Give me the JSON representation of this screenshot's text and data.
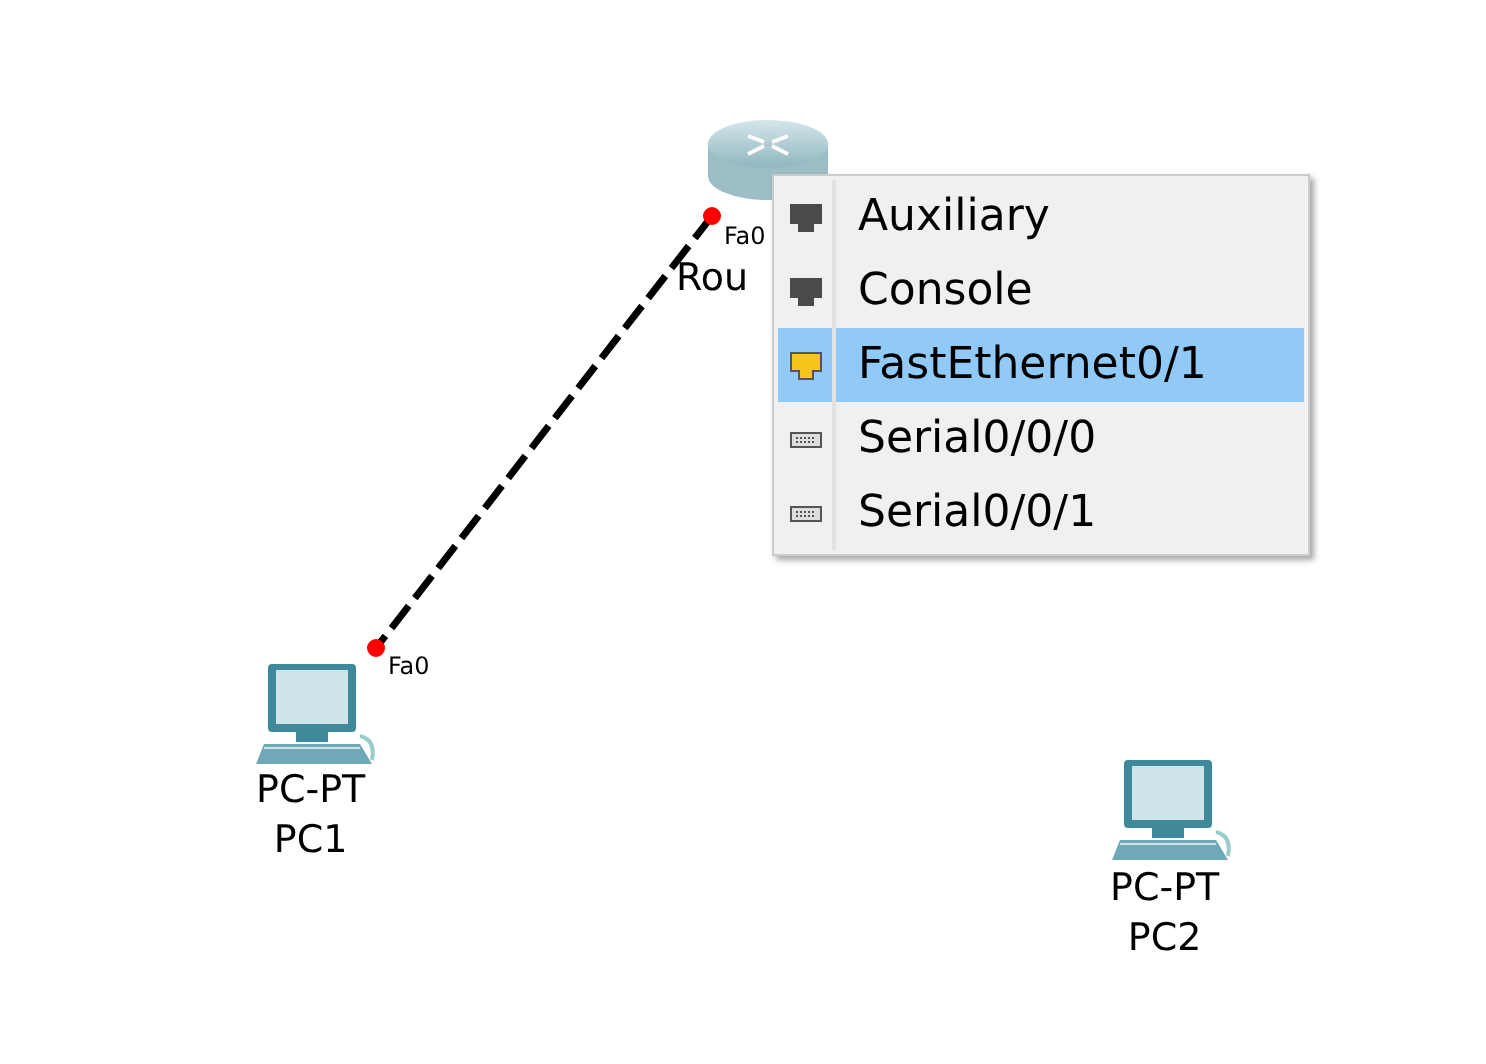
{
  "devices": [
    {
      "kind": "router",
      "labels": [
        "Rou"
      ]
    },
    {
      "kind": "pc",
      "labels": [
        "PC-PT",
        "PC1"
      ]
    },
    {
      "kind": "pc",
      "labels": [
        "PC-PT",
        "PC2"
      ]
    }
  ],
  "links": [
    {
      "from_port": "Fa0",
      "to_port": "Fa0"
    }
  ],
  "port_menu": {
    "items": [
      {
        "label": "Auxiliary",
        "kind": "console",
        "selected": false
      },
      {
        "label": "Console",
        "kind": "console",
        "selected": false
      },
      {
        "label": "FastEthernet0/1",
        "kind": "ethernet",
        "selected": true
      },
      {
        "label": "Serial0/0/0",
        "kind": "serial",
        "selected": false
      },
      {
        "label": "Serial0/0/1",
        "kind": "serial",
        "selected": false
      }
    ]
  }
}
